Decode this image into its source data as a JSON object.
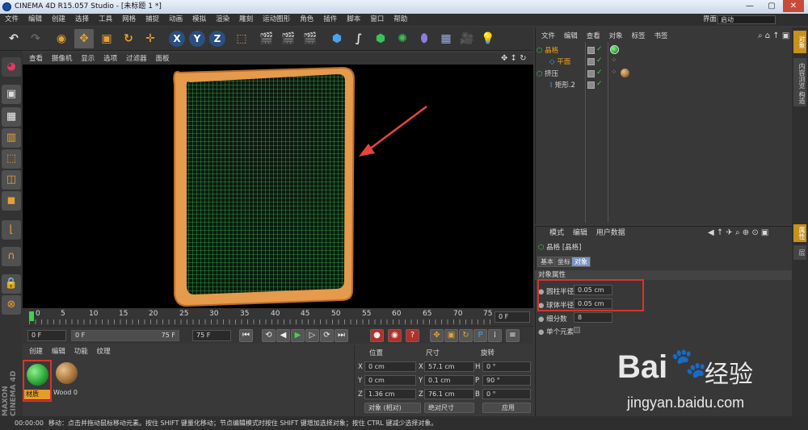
{
  "window": {
    "title": "CINEMA 4D R15.057 Studio - [未标题 1 *]",
    "minimize": "—",
    "maximize": "▢",
    "close": "✕"
  },
  "menu": {
    "items": [
      "文件",
      "编辑",
      "创建",
      "选择",
      "工具",
      "网格",
      "捕捉",
      "动画",
      "模拟",
      "渲染",
      "雕刻",
      "运动图形",
      "角色",
      "插件",
      "脚本",
      "窗口",
      "帮助"
    ],
    "layout_label": "界面:",
    "layout_value": "启动"
  },
  "toolbar": {
    "x": "X",
    "y": "Y",
    "z": "Z"
  },
  "viewport": {
    "menu": [
      "查看",
      "摄像机",
      "显示",
      "选项",
      "过滤器",
      "面板"
    ],
    "colors": {
      "frame": "#e59a4c",
      "grid": "#3db85a",
      "arrow": "#e8463c"
    }
  },
  "timeline": {
    "ticks": [
      "0",
      "5",
      "10",
      "15",
      "20",
      "25",
      "30",
      "35",
      "40",
      "45",
      "50",
      "55",
      "60",
      "65",
      "70",
      "75"
    ],
    "end_frame": "0 F",
    "start_field": "0 F",
    "range_start": "0 F",
    "range_end": "75 F",
    "max_field": "75 F"
  },
  "materials": {
    "menu": [
      "创建",
      "编辑",
      "功能",
      "纹理"
    ],
    "items": [
      {
        "name": "材质",
        "color": "#2fa83a"
      },
      {
        "name": "Wood 0",
        "color": "#a8733c"
      }
    ]
  },
  "coords": {
    "headers": {
      "position": "位置",
      "size": "尺寸",
      "rotation": "旋转"
    },
    "rows": [
      {
        "axis": "X",
        "pos": "0 cm",
        "saxis": "X",
        "size": "57.1 cm",
        "raxis": "H",
        "rot": "0 °"
      },
      {
        "axis": "Y",
        "pos": "0 cm",
        "saxis": "Y",
        "size": "0.1 cm",
        "raxis": "P",
        "rot": "90 °"
      },
      {
        "axis": "Z",
        "pos": "1.36 cm",
        "saxis": "Z",
        "size": "76.1 cm",
        "raxis": "B",
        "rot": "0 °"
      }
    ],
    "mode_select": "对象 (相对)",
    "size_select": "绝对尺寸",
    "apply": "应用"
  },
  "status": {
    "time": "00:00:00",
    "message": "移动：点击并拖动鼠标移动元素。按住 SHIFT 键量化移动；节点编辑模式时按住 SHIFT 键增加选择对象；按住 CTRL 键减少选择对象。"
  },
  "object_manager": {
    "menu": [
      "文件",
      "编辑",
      "查看",
      "对象",
      "标签",
      "书签"
    ],
    "objects": [
      {
        "name": "晶格",
        "indent": 0,
        "color": "#f0a020"
      },
      {
        "name": "平面",
        "indent": 1,
        "color": "#f0a020"
      },
      {
        "name": "挤压",
        "indent": 0,
        "color": "#d8d8d8"
      },
      {
        "name": "矩形.2",
        "indent": 1,
        "color": "#d8d8d8"
      }
    ]
  },
  "attributes": {
    "menu": [
      "模式",
      "编辑",
      "用户数据"
    ],
    "object_title": "晶格 [晶格]",
    "tabs": [
      "基本",
      "坐标",
      "对象"
    ],
    "section": "对象属性",
    "fields": [
      {
        "label": "圆柱半径",
        "value": "0.05 cm"
      },
      {
        "label": "球体半径",
        "value": "0.05 cm"
      },
      {
        "label": "细分数",
        "value": "8"
      },
      {
        "label": "单个元素",
        "value": ""
      }
    ],
    "highlight_color": "#d9332b"
  },
  "right_tabs": [
    "对象",
    "内容浏览器",
    "构造",
    "属性",
    "层"
  ],
  "watermark": {
    "brand": "Bai",
    "brand2": "经验",
    "url": "jingyan.baidu.com"
  }
}
